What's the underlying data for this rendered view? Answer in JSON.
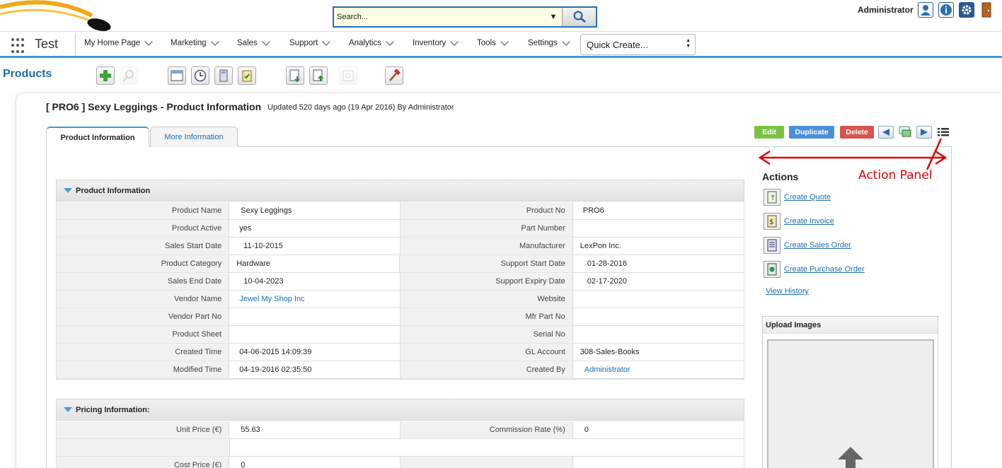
{
  "header": {
    "search": {
      "placeholder": "Search...",
      "value": "Search..."
    },
    "user_name": "Administrator",
    "icons": [
      "user-icon",
      "info-icon",
      "gear-icon",
      "logout-icon"
    ]
  },
  "nav": {
    "app_name": "Test",
    "items": [
      {
        "label": "My Home Page"
      },
      {
        "label": "Marketing"
      },
      {
        "label": "Sales"
      },
      {
        "label": "Support"
      },
      {
        "label": "Analytics"
      },
      {
        "label": "Inventory"
      },
      {
        "label": "Tools"
      },
      {
        "label": "Settings"
      }
    ],
    "quick_create": "Quick Create..."
  },
  "module": {
    "title": "Products"
  },
  "record": {
    "title": "[ PRO6 ] Sexy Leggings - Product Information",
    "updated": "Updated 520 days ago (19 Apr 2016) By Administrator",
    "tabs": [
      {
        "label": "Product Information"
      },
      {
        "label": "More Information"
      }
    ],
    "buttons": {
      "edit": "Edit",
      "duplicate": "Duplicate",
      "delete": "Delete"
    }
  },
  "product_section": {
    "title": "Product Information",
    "rows": [
      [
        "Product Name",
        "Sexy Leggings",
        "Product No",
        "PRO6"
      ],
      [
        "Product Active",
        "yes",
        "Part Number",
        ""
      ],
      [
        "Sales Start Date",
        "11-10-2015",
        "Manufacturer",
        "LexPon Inc."
      ],
      [
        "Product Category",
        "Hardware",
        "Support Start Date",
        "01-28-2016"
      ],
      [
        "Sales End Date",
        "10-04-2023",
        "Support Expiry Date",
        "02-17-2020"
      ],
      [
        "Vendor Name",
        "Jewel My Shop Inc",
        "Website",
        ""
      ],
      [
        "Vendor Part No",
        "",
        "Mfr Part No",
        ""
      ],
      [
        "Product Sheet",
        "",
        "Serial No",
        ""
      ],
      [
        "Created Time",
        "04-06-2015 14:09:39",
        "GL Account",
        "308-Sales-Books"
      ],
      [
        "Modified Time",
        "04-19-2016 02:35:50",
        "Created By",
        "Administrator"
      ]
    ]
  },
  "pricing_section": {
    "title": "Pricing Information:",
    "rows": [
      [
        "Unit Price (€)",
        "55.63",
        "Commission Rate (%)",
        "0"
      ],
      [
        "",
        "",
        "",
        ""
      ],
      [
        "Cost Price (€)",
        "0",
        "",
        ""
      ]
    ]
  },
  "actions_panel": {
    "title": "Actions",
    "items": [
      {
        "label": "Create Quote"
      },
      {
        "label": "Create Invoice"
      },
      {
        "label": "Create Sales Order"
      },
      {
        "label": "Create Purchase Order"
      }
    ],
    "view_history": "View History",
    "upload_title": "Upload Images"
  },
  "annotation": {
    "label": "Action Panel",
    "color": "#e00000"
  },
  "colors": {
    "accent": "#3a9ad9",
    "link": "#1a6fb0",
    "edit": "#7cc242",
    "duplicate": "#4a90d9",
    "delete": "#d9534f"
  }
}
